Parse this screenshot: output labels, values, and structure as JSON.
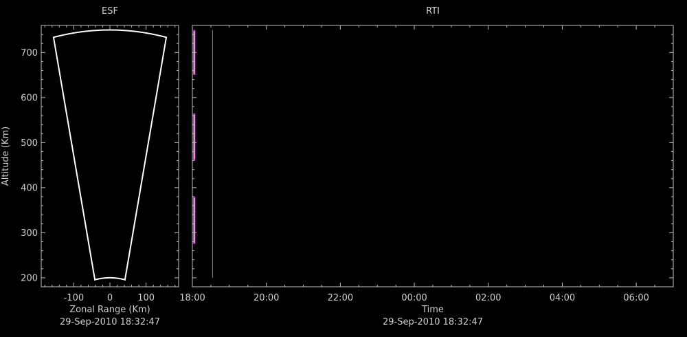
{
  "colors": {
    "background": "#000000",
    "axes": "#bfbfbf",
    "text": "#cfcfcf",
    "fan": "#ffffff",
    "echo": "#d21fd2",
    "echo_core": "#ffffff",
    "marker": "#d2691e"
  },
  "chart_data": [
    {
      "type": "fan",
      "title": "ESF",
      "xlabel": "Zonal Range (Km)",
      "ylabel": "Altitude (Km)",
      "date_label": "29-Sep-2010 18:32:47",
      "xlim": [
        -190,
        190
      ],
      "ylim": [
        180,
        760
      ],
      "xticks": [
        -100,
        0,
        100
      ],
      "xtick_labels": [
        "-100",
        "0",
        "100"
      ],
      "yticks": [
        200,
        300,
        400,
        500,
        600,
        700
      ],
      "ytick_labels": [
        "200",
        "300",
        "400",
        "500",
        "600",
        "700"
      ],
      "fan": {
        "r_min": 200,
        "r_max": 750,
        "half_angle_deg": 12
      }
    },
    {
      "type": "heatmap",
      "title": "RTI",
      "xlabel": "Time",
      "date_label": "29-Sep-2010 18:32:47",
      "xlim": [
        "18:00",
        "07:00"
      ],
      "ylim": [
        180,
        760
      ],
      "xticks": [
        "18:00",
        "20:00",
        "22:00",
        "00:00",
        "02:00",
        "04:00",
        "06:00"
      ],
      "yticks": [
        200,
        300,
        400,
        500,
        600,
        700
      ],
      "echo_time_range": [
        "18:00",
        "18:05"
      ],
      "echo_bands": [
        {
          "alt_min": 650,
          "alt_max": 750
        },
        {
          "alt_min": 460,
          "alt_max": 565
        },
        {
          "alt_min": 275,
          "alt_max": 380
        }
      ],
      "current_time_marker": {
        "time": "18:32:47",
        "alt_min": 200,
        "alt_max": 750
      }
    }
  ]
}
